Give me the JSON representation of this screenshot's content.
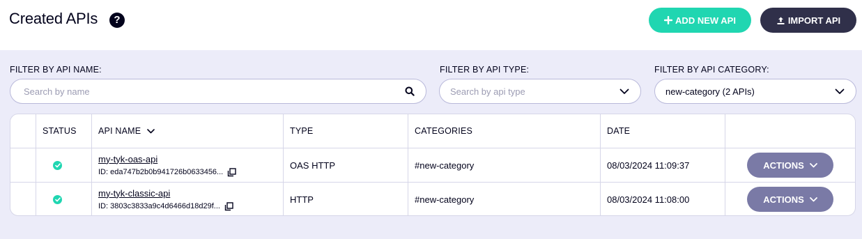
{
  "page": {
    "title": "Created APIs",
    "help_icon": "question-circle-icon",
    "add_button": "ADD NEW API",
    "import_button": "IMPORT API"
  },
  "filters": {
    "name_label": "FILTER BY API NAME:",
    "name_placeholder": "Search by name",
    "type_label": "FILTER BY API TYPE:",
    "type_placeholder": "Search by api type",
    "category_label": "FILTER BY API CATEGORY:",
    "category_value": "new-category (2 APIs)"
  },
  "table": {
    "columns": [
      "STATUS",
      "API NAME",
      "TYPE",
      "CATEGORIES",
      "DATE"
    ],
    "rows": [
      {
        "status": "active",
        "name": "my-tyk-oas-api",
        "id": "ID: eda747b2b0b941726b0633456...",
        "type": "OAS HTTP",
        "categories": "#new-category",
        "date": "08/03/2024 11:09:37",
        "action": "ACTIONS"
      },
      {
        "status": "active",
        "name": "my-tyk-classic-api",
        "id": "ID: 3803c3833a9c4d6466d18d29f...",
        "type": "HTTP",
        "categories": "#new-category",
        "date": "08/03/2024 11:08:00",
        "action": "ACTIONS"
      }
    ]
  },
  "colors": {
    "accent": "#20d6b1",
    "dark": "#30304a",
    "actions": "#7a7aa6",
    "panel_bg": "#ececf9"
  }
}
